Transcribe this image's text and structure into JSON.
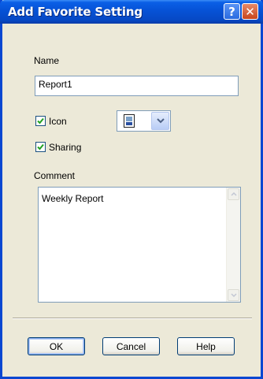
{
  "window": {
    "title": "Add Favorite Setting",
    "help_glyph": "?",
    "close_glyph": "✕"
  },
  "form": {
    "name_label": "Name",
    "name_value": "Report1",
    "icon_label": "Icon",
    "icon_checked": true,
    "sharing_label": "Sharing",
    "sharing_checked": true,
    "comment_label": "Comment",
    "comment_value": "Weekly Report"
  },
  "buttons": {
    "ok": "OK",
    "cancel": "Cancel",
    "help": "Help"
  },
  "icons": {
    "check": "checkmark-icon",
    "dropdown": "chevron-down-icon",
    "doc": "document-icon"
  },
  "colors": {
    "titlebar": "#0652d6",
    "dialog_bg": "#ece9d8",
    "field_border": "#7f9db9",
    "check_mark": "#21a121"
  }
}
